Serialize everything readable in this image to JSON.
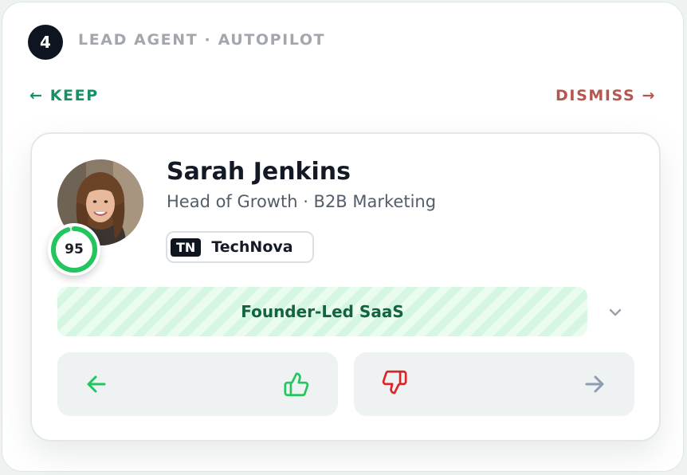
{
  "header": {
    "step_number": "4",
    "title": "LEAD AGENT · AUTOPILOT"
  },
  "swipe_hints": {
    "keep_label": "← KEEP",
    "dismiss_label": "DISMISS →"
  },
  "lead": {
    "name": "Sarah Jenkins",
    "title_line": "Head of Growth · B2B Marketing",
    "score": "95",
    "score_fraction": 0.95,
    "company_logo_text": "TN",
    "company_name": "TechNova",
    "segment": "Founder-Led SaaS"
  },
  "icons": {
    "keep_arrow": "arrow-left-icon",
    "thumbs_up": "thumbs-up-icon",
    "thumbs_down": "thumbs-down-icon",
    "dismiss_arrow": "arrow-right-icon",
    "expand": "chevron-down-icon"
  },
  "colors": {
    "keep": "#179163",
    "dismiss": "#b4574f",
    "score_ring": "#22c55e",
    "thumbs_down": "#dc2626"
  }
}
